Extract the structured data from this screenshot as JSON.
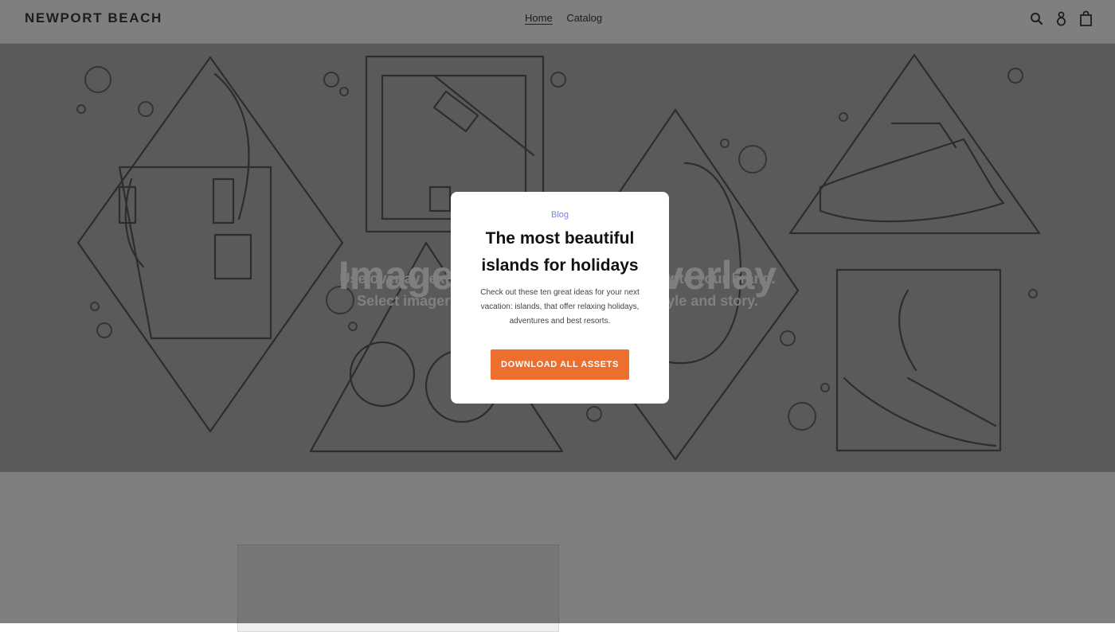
{
  "header": {
    "brand": "NEWPORT BEACH",
    "nav": [
      {
        "label": "Home",
        "active": true
      },
      {
        "label": "Catalog",
        "active": false
      }
    ],
    "icons": [
      "search-icon",
      "account-icon",
      "cart-icon"
    ]
  },
  "hero": {
    "title": "Image with text overlay",
    "subtitle": "Use overlay text to give your customers insight into your brand. Select imagery and text that relates to your style and story."
  },
  "modal": {
    "category": "Blog",
    "title": "The most beautiful islands for holidays",
    "text": "Check out these ten great ideas for your next vacation: islands, that offer relaxing holidays, adventures and best resorts.",
    "button_label": "DOWNLOAD ALL ASSETS"
  },
  "colors": {
    "accent": "#ec6f2e",
    "link": "#7a86d8",
    "hero_bg": "#b4b4b4",
    "overlay": "rgba(0,0,0,0.5)"
  }
}
